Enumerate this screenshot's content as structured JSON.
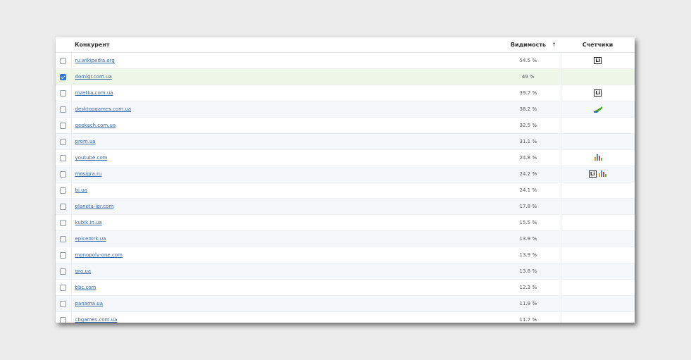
{
  "header": {
    "competitor": "Конкурент",
    "visibility": "Видимость",
    "sort_arrow": "↑",
    "counters": "Счетчики"
  },
  "rows": [
    {
      "site": "ru.wikipedia.org",
      "visibility": "54.5 %",
      "checked": false,
      "counters": [
        "li-icon"
      ]
    },
    {
      "site": "domigr.com.ua",
      "visibility": "49 %",
      "checked": true,
      "counters": []
    },
    {
      "site": "rozetka.com.ua",
      "visibility": "39.7 %",
      "checked": false,
      "counters": [
        "li-icon"
      ]
    },
    {
      "site": "desktopgames.com.ua",
      "visibility": "38.2 %",
      "checked": false,
      "counters": [
        "stats-arrow-icon"
      ]
    },
    {
      "site": "geekach.com.ua",
      "visibility": "32.5 %",
      "checked": false,
      "counters": []
    },
    {
      "site": "prom.ua",
      "visibility": "31.1 %",
      "checked": false,
      "counters": []
    },
    {
      "site": "youtube.com",
      "visibility": "24.8 %",
      "checked": false,
      "counters": [
        "bar-chart-icon"
      ]
    },
    {
      "site": "mosigra.ru",
      "visibility": "24.2 %",
      "checked": false,
      "counters": [
        "li-icon",
        "bar-chart-icon"
      ]
    },
    {
      "site": "bi.ua",
      "visibility": "24.1 %",
      "checked": false,
      "counters": []
    },
    {
      "site": "planeta-igr.com",
      "visibility": "17.8 %",
      "checked": false,
      "counters": []
    },
    {
      "site": "kubik.in.ua",
      "visibility": "15.5 %",
      "checked": false,
      "counters": []
    },
    {
      "site": "epicentrk.ua",
      "visibility": "13.9 %",
      "checked": false,
      "counters": []
    },
    {
      "site": "monopoly-one.com",
      "visibility": "13.9 %",
      "checked": false,
      "counters": []
    },
    {
      "site": "gra.ua",
      "visibility": "13.8 %",
      "checked": false,
      "counters": []
    },
    {
      "site": "bbc.com",
      "visibility": "12.3 %",
      "checked": false,
      "counters": []
    },
    {
      "site": "panama.ua",
      "visibility": "11.9 %",
      "checked": false,
      "counters": []
    },
    {
      "site": "cbgames.com.ua",
      "visibility": "11.7 %",
      "checked": false,
      "counters": []
    }
  ],
  "counter_labels": {
    "li": "Li"
  }
}
